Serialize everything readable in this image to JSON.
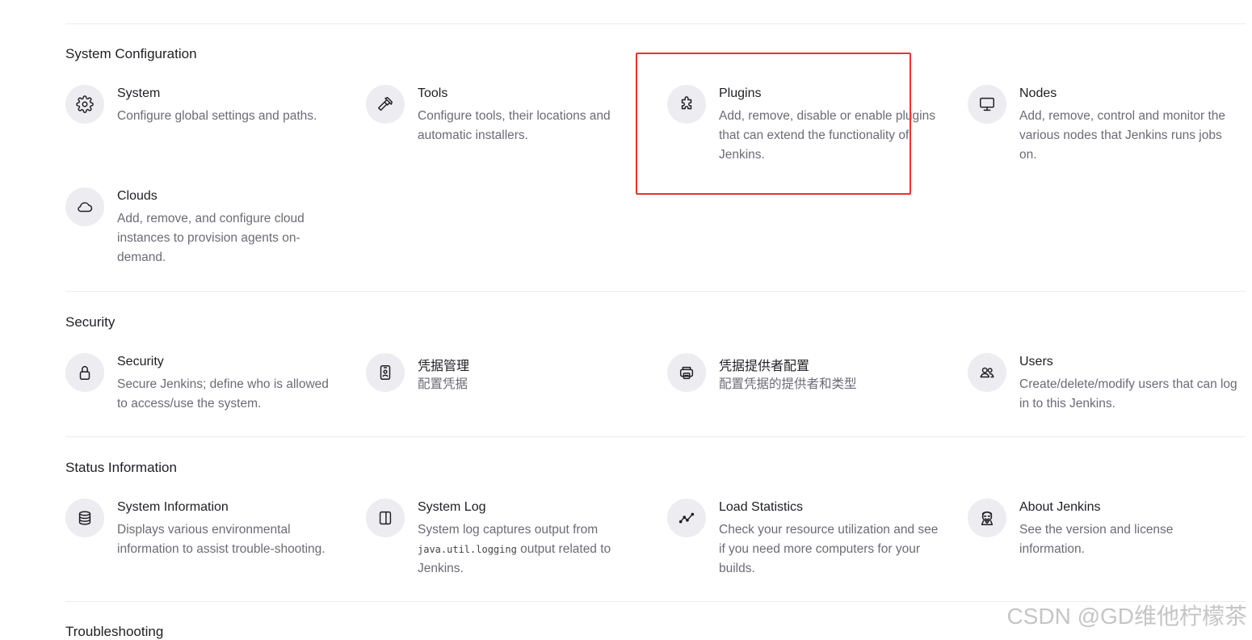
{
  "sections": {
    "system_configuration": {
      "title": "System Configuration",
      "items": [
        {
          "icon": "gear-icon",
          "title": "System",
          "desc": "Configure global settings and paths."
        },
        {
          "icon": "hammer-icon",
          "title": "Tools",
          "desc": "Configure tools, their locations and automatic installers."
        },
        {
          "icon": "puzzle-icon",
          "title": "Plugins",
          "desc": "Add, remove, disable or enable plugins that can extend the functionality of Jenkins."
        },
        {
          "icon": "monitor-icon",
          "title": "Nodes",
          "desc": "Add, remove, control and monitor the various nodes that Jenkins runs jobs on."
        },
        {
          "icon": "cloud-icon",
          "title": "Clouds",
          "desc": "Add, remove, and configure cloud instances to provision agents on-demand."
        }
      ]
    },
    "security": {
      "title": "Security",
      "items": [
        {
          "icon": "lock-icon",
          "title": "Security",
          "desc": "Secure Jenkins; define who is allowed to access/use the system."
        },
        {
          "icon": "id-card-icon",
          "title": "凭据管理",
          "desc": "配置凭据"
        },
        {
          "icon": "credential-provider-icon",
          "title": "凭据提供者配置",
          "desc": "配置凭据的提供者和类型"
        },
        {
          "icon": "users-icon",
          "title": "Users",
          "desc": "Create/delete/modify users that can log in to this Jenkins."
        }
      ]
    },
    "status_information": {
      "title": "Status Information",
      "items": [
        {
          "icon": "database-icon",
          "title": "System Information",
          "desc": "Displays various environmental information to assist trouble-shooting."
        },
        {
          "icon": "log-panel-icon",
          "title": "System Log",
          "desc_pre": "System log captures output from ",
          "desc_code": "java.util.logging",
          "desc_post": " output related to Jenkins."
        },
        {
          "icon": "trend-line-icon",
          "title": "Load Statistics",
          "desc": "Check your resource utilization and see if you need more computers for your builds."
        },
        {
          "icon": "jenkins-logo-icon",
          "title": "About Jenkins",
          "desc": "See the version and license information."
        }
      ]
    },
    "troubleshooting": {
      "title": "Troubleshooting"
    }
  },
  "watermark": "CSDN @GD维他柠檬茶",
  "colors": {
    "highlight_border": "#e8332f",
    "icon_bg": "#ececf1",
    "desc_text": "#6b6b76"
  }
}
